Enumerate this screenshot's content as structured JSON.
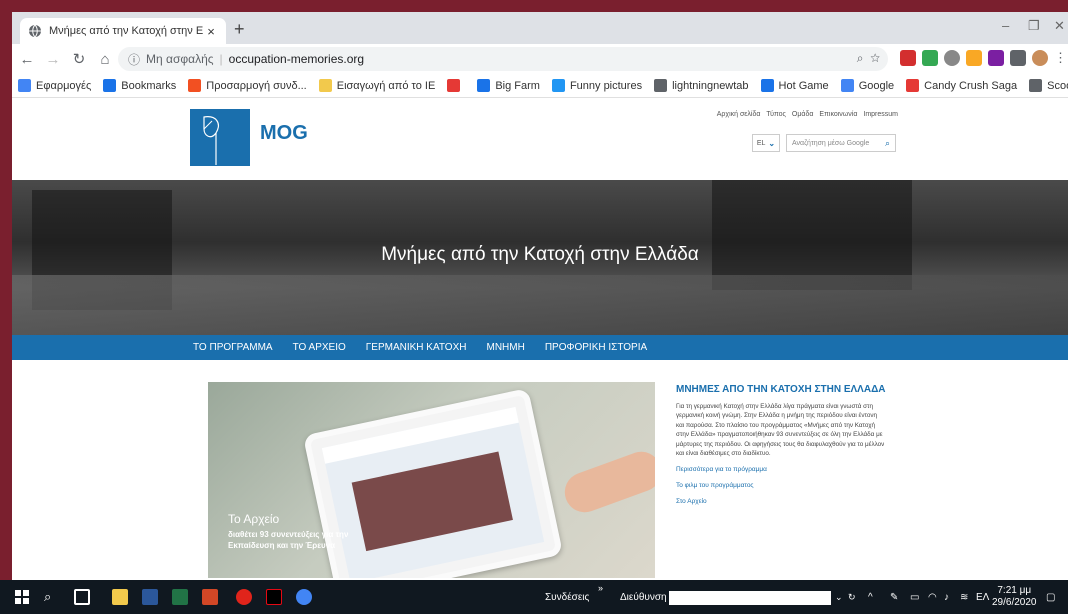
{
  "browser": {
    "tab_title": "Μνήμες από την Κατοχή στην Ε",
    "tab_close": "×",
    "new_tab": "+",
    "window_controls": [
      "–",
      "❐",
      "✕"
    ],
    "insecure_label": "Μη ασφαλής",
    "url": "occupation-memories.org",
    "nav_icons": [
      "back-icon",
      "forward-icon",
      "reload-icon",
      "home-icon"
    ]
  },
  "bookmarks": [
    {
      "label": "Εφαρμογές",
      "icon": "apps-icon",
      "color": "#4285f4"
    },
    {
      "label": "Bookmarks",
      "icon": "star-icon",
      "color": "#1a73e8"
    },
    {
      "label": "Προσαρμογή συνδ...",
      "icon": "windows-icon",
      "color": "#f25022"
    },
    {
      "label": "Εισαγωγή από το IE",
      "icon": "folder-icon",
      "color": "#f2c94c"
    },
    {
      "label": "",
      "icon": "heart-icon",
      "color": "#e53935"
    },
    {
      "label": "Big Farm",
      "icon": "bigfarm-icon",
      "color": "#1a73e8"
    },
    {
      "label": "Funny pictures",
      "icon": "funny-icon",
      "color": "#2196f3"
    },
    {
      "label": "lightningnewtab",
      "icon": "globe-icon",
      "color": "#5f6368"
    },
    {
      "label": "Hot Game",
      "icon": "hotgame-icon",
      "color": "#1a73e8"
    },
    {
      "label": "Google",
      "icon": "google-icon",
      "color": "#4285f4"
    },
    {
      "label": "Candy Crush Saga",
      "icon": "candy-icon",
      "color": "#e53935"
    },
    {
      "label": "Scoop.it!",
      "icon": "globe-icon",
      "color": "#5f6368"
    }
  ],
  "bookmarks_more": "»",
  "site": {
    "logo_text": "MOG",
    "top_nav": [
      "Αρχική σελίδα",
      "Τύπος",
      "Ομάδα",
      "Επικοινωνία",
      "Impressum"
    ],
    "language": "EL",
    "search_placeholder": "Αναζήτηση μέσω Google",
    "hero_title": "Μνήμες από την Κατοχή στην Ελλάδα",
    "main_nav": [
      "ΤΟ ΠΡΟΓΡΑΜΜΑ",
      "ΤΟ ΑΡΧΕΙΟ",
      "ΓΕΡΜΑΝΙΚΗ ΚΑΤΟΧΗ",
      "ΜΝΗΜΗ",
      "ΠΡΟΦΟΡΙΚΗ ΙΣΤΟΡΙΑ"
    ],
    "feature_title": "Το Αρχείο",
    "feature_subtitle": "διαθέτει 93 συνεντεύξεις για την Εκπαίδευση και την Έρευνα",
    "side_heading": "ΜΝΗΜΕΣ ΑΠΟ ΤΗΝ ΚΑΤΟΧΗ ΣΤΗΝ ΕΛΛΑΔΑ",
    "side_text": "Για τη γερμανική Κατοχή στην Ελλάδα λίγα πράγματα είναι γνωστά στη γερμανική κοινή γνώμη. Στην Ελλάδα η μνήμη της περιόδου είναι έντονη και παρούσα. Στο πλαίσιο του προγράμματος «Μνήμες από την Κατοχή στην Ελλάδα» πραγματοποιήθηκαν 93 συνεντεύξεις σε όλη την Ελλάδα με μάρτυρες της περιόδου. Οι αφηγήσεις τους θα διαφυλαχθούν για το μέλλον και είναι διαθέσιμες στο διαδίκτυο.",
    "side_links": [
      "Περισσότερα για το πρόγραμμα",
      "Το φιλμ του προγράμματος",
      "Στο Αρχείο"
    ]
  },
  "taskbar": {
    "connections_label": "Συνδέσεις",
    "connections_chevron": "»",
    "address_label": "Διεύθυνση",
    "language": "ΕΛ",
    "time": "7:21 μμ",
    "date": "29/6/2020"
  }
}
